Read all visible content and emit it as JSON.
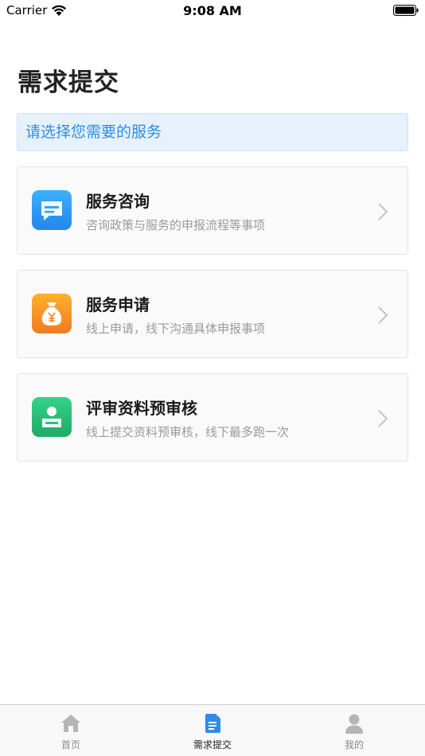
{
  "status_bar": {
    "carrier": "Carrier",
    "time": "9:08 AM"
  },
  "page": {
    "title": "需求提交"
  },
  "notice": {
    "text": "请选择您需要的服务"
  },
  "services": [
    {
      "title": "服务咨询",
      "subtitle": "咨询政策与服务的申报流程等事项",
      "icon": "chat-icon",
      "color": "#2c9cf3"
    },
    {
      "title": "服务申请",
      "subtitle": "线上申请，线下沟通具体申报事项",
      "icon": "money-bag-icon",
      "color": "#f5962a"
    },
    {
      "title": "评审资料预审核",
      "subtitle": "线上提交资料预审核，线下最多跑一次",
      "icon": "id-card-icon",
      "color": "#27bd75"
    }
  ],
  "tabs": [
    {
      "label": "首页",
      "icon": "home-icon",
      "active": false
    },
    {
      "label": "需求提交",
      "icon": "document-icon",
      "active": true
    },
    {
      "label": "我的",
      "icon": "user-icon",
      "active": false
    }
  ],
  "colors": {
    "accent": "#2f8de4",
    "notice_bg": "#e6f1fb"
  }
}
